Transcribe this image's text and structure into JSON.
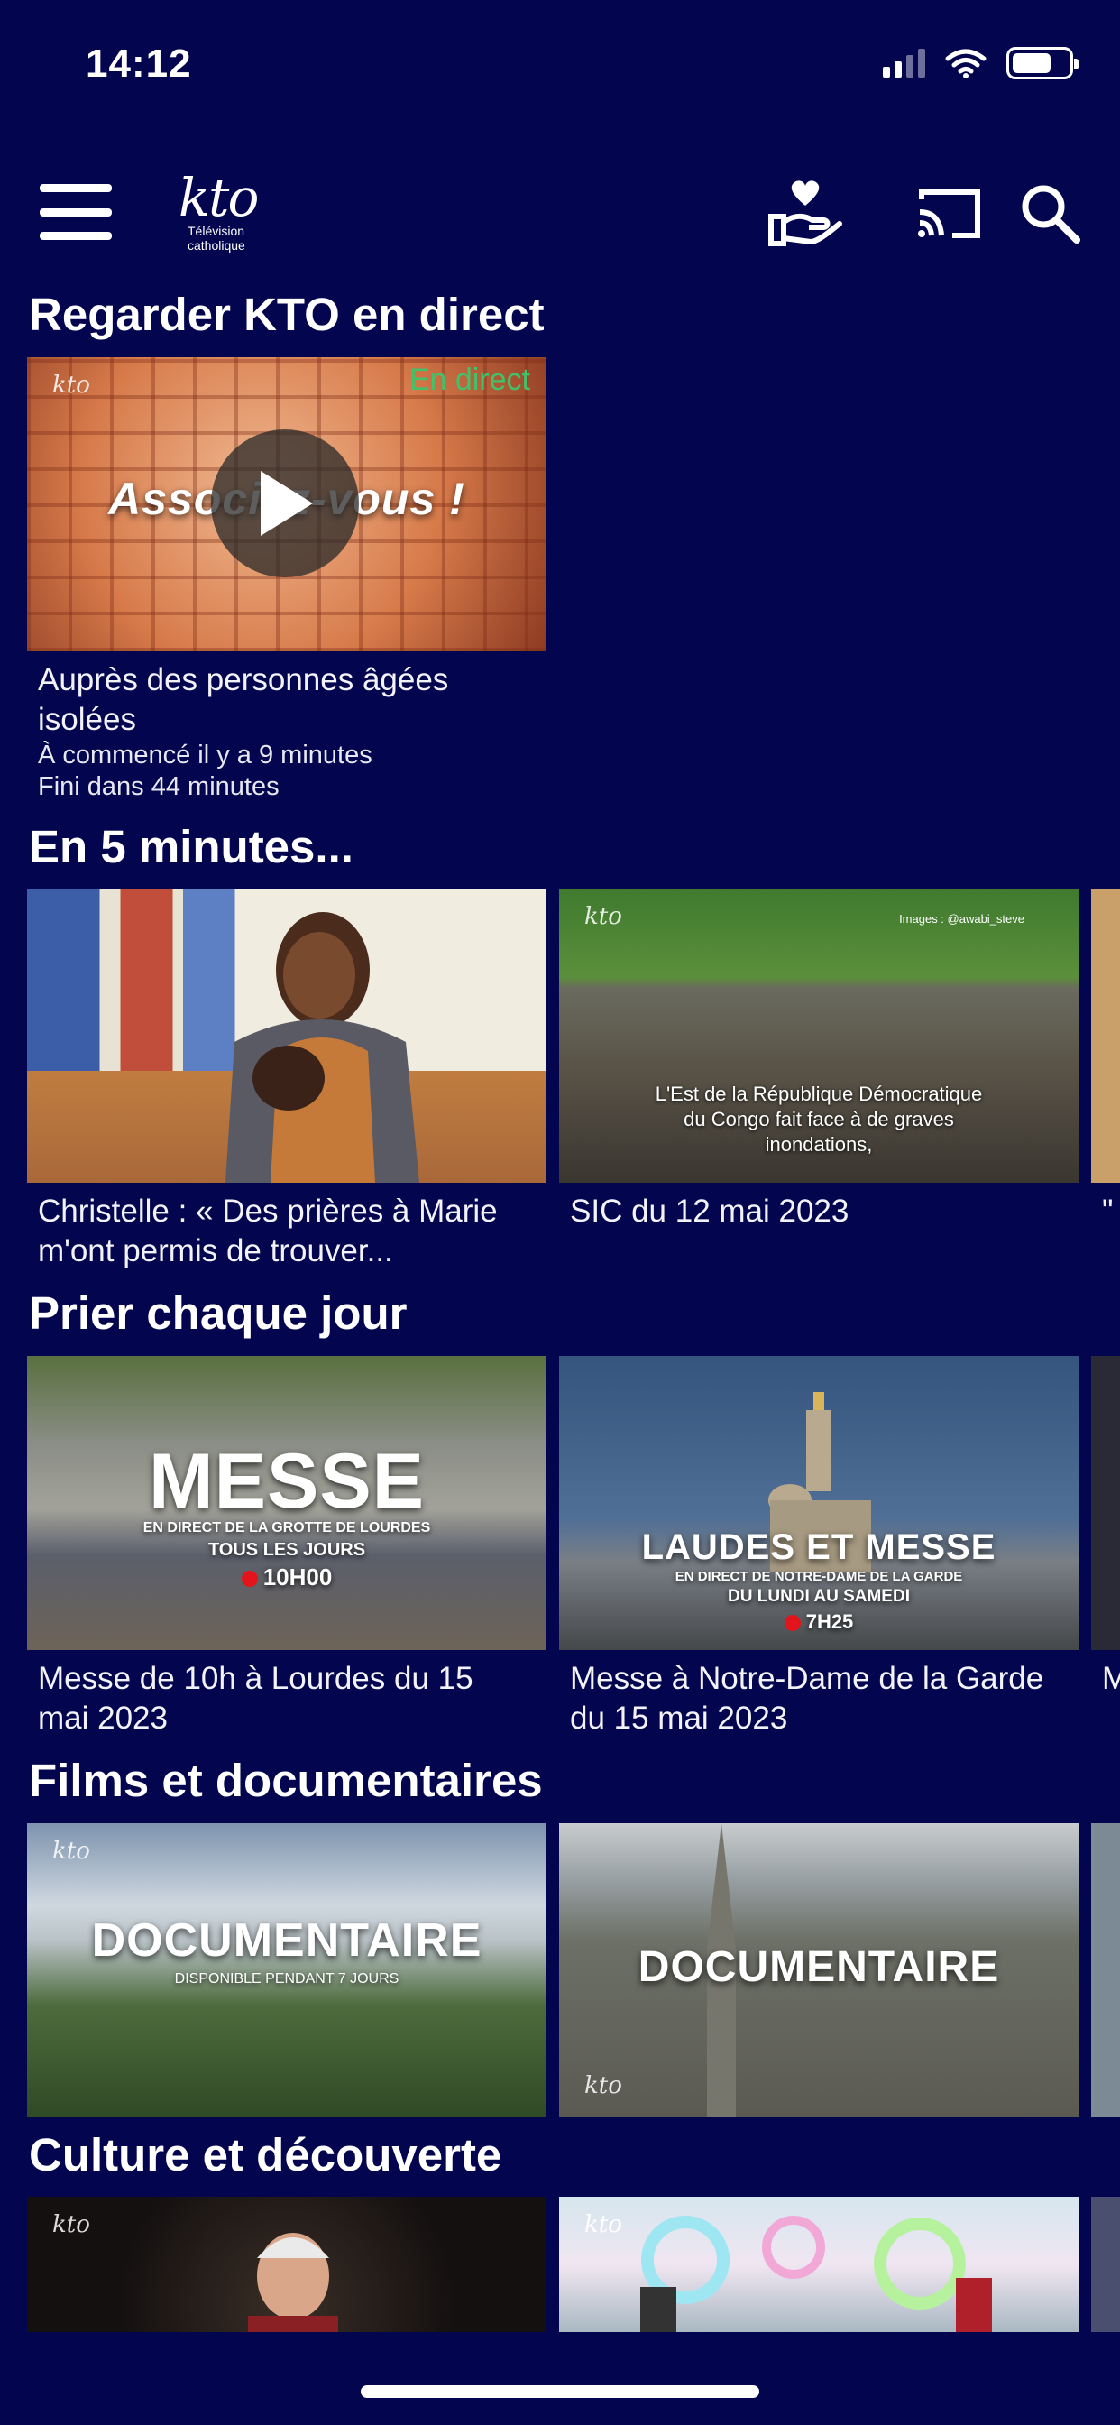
{
  "status_bar": {
    "time": "14:12"
  },
  "header": {
    "logo_text": "kto",
    "logo_subtitle": "Télévision catholique",
    "icons": [
      "menu-icon",
      "donate-icon",
      "cast-icon",
      "search-icon"
    ]
  },
  "sections": [
    {
      "title": "Regarder KTO en direct",
      "cards": [
        {
          "title": "Auprès des personnes âgées isolées",
          "meta1": "À commencé il y a 9 minutes",
          "meta2": "Fini dans 44 minutes",
          "live_label": "En direct",
          "thumb_text": "Associez-vous !"
        }
      ]
    },
    {
      "title": "En 5 minutes...",
      "cards": [
        {
          "title": "Christelle : « Des prières à Marie m'ont permis de trouver..."
        },
        {
          "title": "SIC du 12 mai 2023",
          "thumb_subtitle": "L'Est de la République Démocratique du Congo fait face à de graves inondations,",
          "thumb_credit": "Images : @awabi_steve"
        },
        {
          "title": "\" fo"
        }
      ]
    },
    {
      "title": "Prier chaque jour",
      "cards": [
        {
          "title": "Messe de 10h à Lourdes du 15 mai 2023",
          "thumb_main": "MESSE",
          "thumb_line1": "EN DIRECT DE LA GROTTE DE LOURDES",
          "thumb_line2": "TOUS LES JOURS",
          "thumb_time": "10H00"
        },
        {
          "title": "Messe à Notre-Dame de la Garde du 15 mai 2023",
          "thumb_main": "LAUDES ET MESSE",
          "thumb_line1": "EN DIRECT DE NOTRE-DAME DE LA GARDE",
          "thumb_line2": "DU LUNDI AU SAMEDI",
          "thumb_time": "7H25"
        },
        {
          "title": "M G"
        }
      ]
    },
    {
      "title": "Films et documentaires",
      "cards": [
        {
          "thumb_main": "DOCUMENTAIRE",
          "thumb_line1": "DISPONIBLE PENDANT 7 JOURS"
        },
        {
          "thumb_main": "DOCUMENTAIRE"
        }
      ]
    },
    {
      "title": "Culture et découverte",
      "cards": [
        {},
        {}
      ]
    }
  ],
  "colors": {
    "background": "#03064f",
    "live": "#43c06a",
    "live_dot": "#e3141b"
  }
}
